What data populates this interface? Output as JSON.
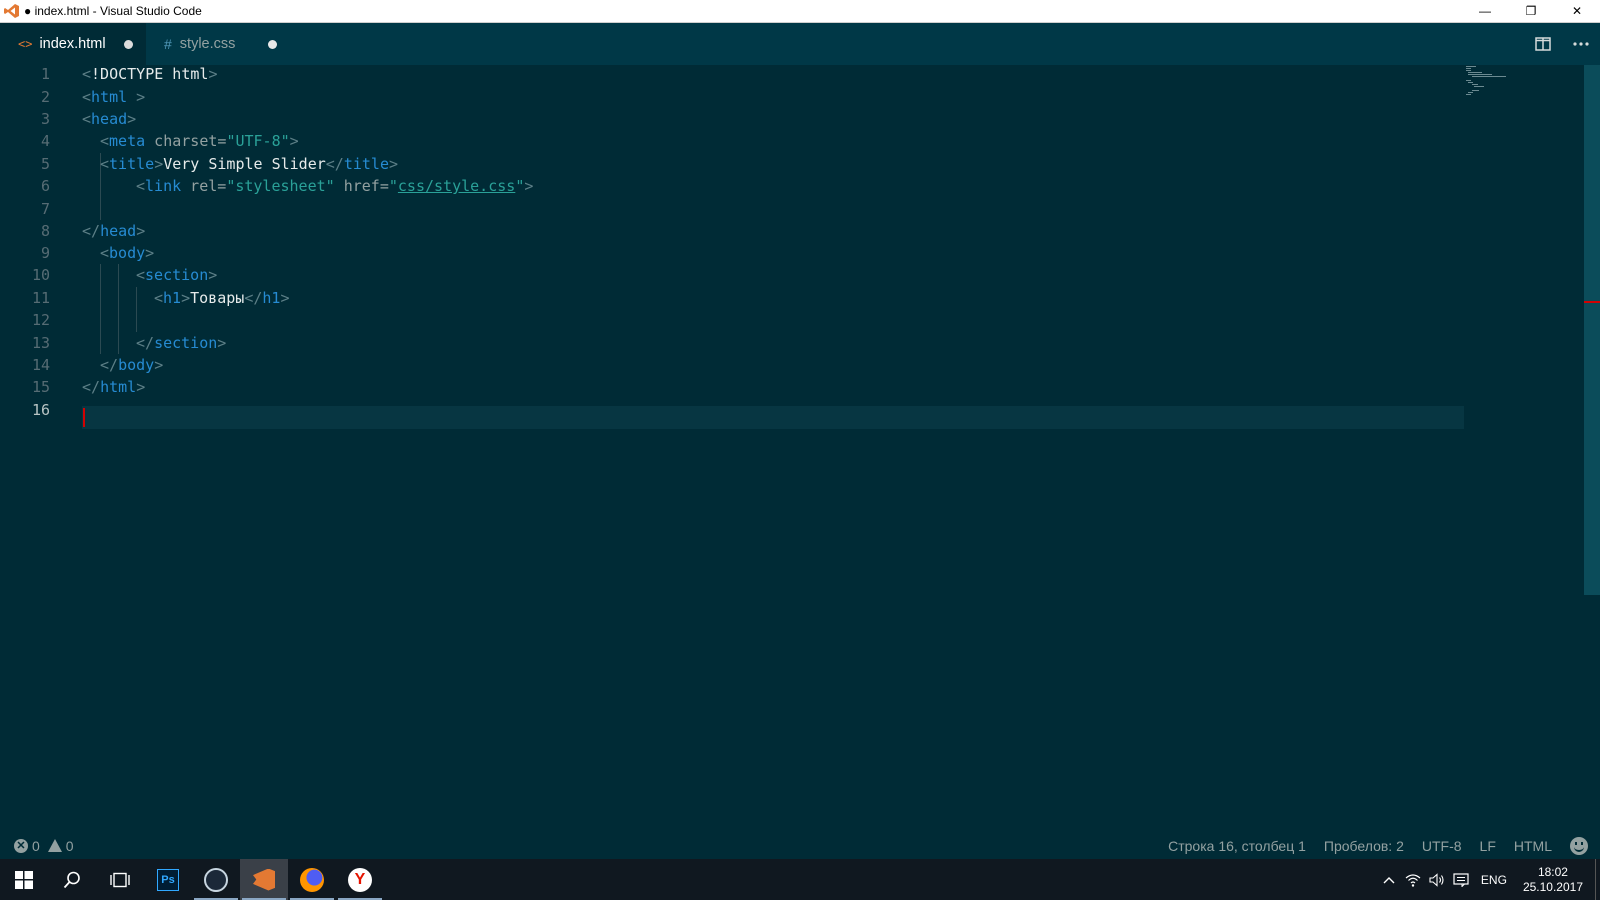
{
  "window": {
    "title": "● index.html - Visual Studio Code",
    "controls": [
      "—",
      "❐",
      "✕"
    ]
  },
  "tabs": [
    {
      "icon": "<>",
      "label": "index.html",
      "modified": true,
      "active": true
    },
    {
      "icon": "#",
      "label": "style.css",
      "modified": true,
      "active": false
    }
  ],
  "editor": {
    "current_line": 16,
    "line_numbers": [
      "1",
      "2",
      "3",
      "4",
      "5",
      "6",
      "7",
      "8",
      "9",
      "10",
      "11",
      "12",
      "13",
      "14",
      "15",
      "16"
    ],
    "code": {
      "l1": {
        "open": "<",
        "tag": "!DOCTYPE html",
        "close": ">"
      },
      "l2": {
        "open": "<",
        "tag": "html",
        "close": " >"
      },
      "l3": {
        "open": "<",
        "tag": "head",
        "close": ">"
      },
      "l4": {
        "open": "<",
        "tag": "meta",
        "attr": " charset=",
        "val": "\"UTF-8\"",
        "close": ">"
      },
      "l5": {
        "open": "<",
        "tag": "title",
        "close": ">",
        "text": "Very Simple Slider",
        "endopen": "</",
        "endtag": "title",
        "endclose": ">"
      },
      "l6": {
        "open": "<",
        "tag": "link",
        "attr1": " rel=",
        "val1": "\"stylesheet\"",
        "attr2": " href=",
        "q1": "\"",
        "link": "css/style.css",
        "q2": "\"",
        "close": ">"
      },
      "l8": {
        "open": "</",
        "tag": "head",
        "close": ">"
      },
      "l9": {
        "open": "<",
        "tag": "body",
        "close": ">"
      },
      "l10": {
        "open": "<",
        "tag": "section",
        "close": ">"
      },
      "l11": {
        "open": "<",
        "tag": "h1",
        "close": ">",
        "text": "Товары",
        "endopen": "</",
        "endtag": "h1",
        "endclose": ">"
      },
      "l13": {
        "open": "</",
        "tag": "section",
        "close": ">"
      },
      "l14": {
        "open": "</",
        "tag": "body",
        "close": ">"
      },
      "l15": {
        "open": "</",
        "tag": "html",
        "close": ">"
      }
    }
  },
  "status": {
    "errors": "0",
    "warnings": "0",
    "position": "Строка 16, столбец 1",
    "spaces": "Пробелов: 2",
    "encoding": "UTF-8",
    "eol": "LF",
    "language": "HTML"
  },
  "taskbar": {
    "apps": [
      "windows-start",
      "search",
      "task-view",
      "photoshop",
      "steam",
      "vscode",
      "firefox",
      "yandex-browser"
    ],
    "ps_label": "Ps",
    "ya_label": "Y",
    "lang": "ENG",
    "time": "18:02",
    "date": "25.10.2017"
  },
  "colors": {
    "editor_bg": "#002b36",
    "tab_bar_bg": "#003847",
    "tag": "#268bd2",
    "string": "#2aa198",
    "cursor": "#d30102"
  }
}
